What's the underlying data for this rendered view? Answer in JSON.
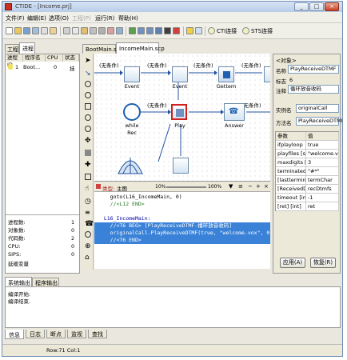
{
  "window": {
    "title": "CTIDE - [Income.prj]"
  },
  "menu": [
    "文件(F)",
    "编辑(E)",
    "选项(O)",
    "工程(P)",
    "运行(R)",
    "帮助(H)"
  ],
  "toolbar": {
    "cti_label": "CTI连接",
    "sts_label": "STS连接"
  },
  "left_tabs": [
    "工程",
    "进程"
  ],
  "process_table": {
    "headers": [
      "进程ID",
      "程序名",
      "CPU",
      "状态"
    ],
    "rows": [
      {
        "id": "1",
        "name": "Boot...",
        "cpu": "0",
        "state": "挂"
      }
    ]
  },
  "stats": [
    {
      "label": "进程数:",
      "value": "1"
    },
    {
      "label": "对象数:",
      "value": "0"
    },
    {
      "label": "代码数:",
      "value": "2"
    },
    {
      "label": "CPU:",
      "value": "0"
    },
    {
      "label": "SIPS:",
      "value": "0"
    },
    {
      "label": "延缓变量",
      "value": ""
    }
  ],
  "doc_tabs": [
    "BootMain.scp",
    "IncomeMain.scp"
  ],
  "flow": {
    "cond": "(无条件)",
    "nodes": [
      "Event",
      "Event",
      "Gettem",
      "while",
      "Rec",
      "Play",
      "Answer"
    ]
  },
  "editor": {
    "type_label": "类型:",
    "type_value": "主图",
    "zoom_percent": "10%",
    "zoom_value": "100%",
    "lines": [
      "    goto(L16_IncomeMain, 0)",
      "    //<L12 END>",
      "",
      "  L16_IncomeMain:",
      "    //<T6 BEG> [PlayReceiveDTMF-播环放音收码]",
      "    originalCall.PlayReceiveDTMF(true, \"welcome.vox\", 0",
      "    //<T6 END>"
    ]
  },
  "object_panel": {
    "header": "<对象>",
    "name_label": "名称",
    "name_value": "PlayReceiveDTMF",
    "mark_label": "标志",
    "mark_value": "6",
    "note_label": "注释",
    "note_value": "循环放音收码",
    "instance_label": "实例名",
    "instance_value": "originalCall",
    "method_label": "方法名",
    "method_value": "PlayReceiveDTMF",
    "params_header": [
      "参数",
      "值"
    ],
    "params": [
      {
        "k": "ifplayloop",
        "v": "true"
      },
      {
        "k": "playfiles [s",
        "v": "\"welcome.vox\""
      },
      {
        "k": "maxdigits [i",
        "v": "3"
      },
      {
        "k": "terminatedch",
        "v": "\"#*\""
      },
      {
        "k": "[lastterminal]",
        "v": "termChar"
      },
      {
        "k": "[ReceivedDig]",
        "v": "recDtmfs"
      },
      {
        "k": "timeout [int]",
        "v": "-1"
      },
      {
        "k": "[ret] [int]",
        "v": "ret"
      }
    ],
    "apply_label": "应用(A)",
    "restore_label": "恢复(R)"
  },
  "output": {
    "tabs": [
      "系统输出",
      "程序输出"
    ],
    "lines": [
      "编译开始:",
      "编译结束."
    ],
    "bottom_tabs": [
      "信息",
      "日志",
      "断点",
      "监视",
      "查找"
    ]
  },
  "status": {
    "text": "Row:71 Col:1"
  }
}
